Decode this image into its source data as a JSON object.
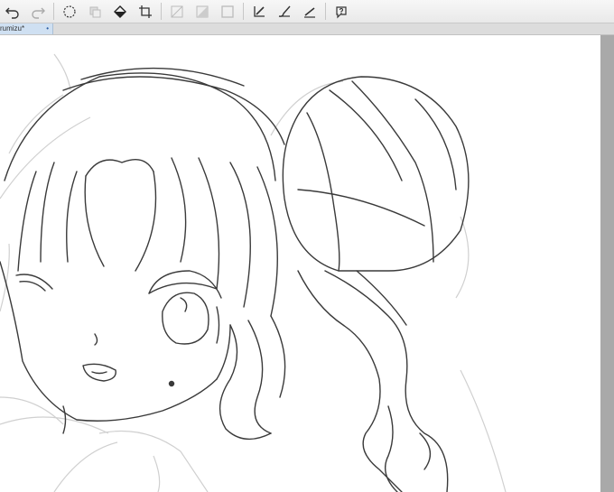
{
  "toolbar": {
    "tools": [
      {
        "icon": "undo-icon"
      },
      {
        "icon": "redo-icon"
      },
      {
        "icon": "lasso-select-icon"
      },
      {
        "icon": "copy-layer-icon"
      },
      {
        "icon": "fill-bucket-icon"
      },
      {
        "icon": "crop-icon"
      },
      {
        "icon": "transparency-grid-icon"
      },
      {
        "icon": "half-tone-icon"
      },
      {
        "icon": "frame-icon"
      },
      {
        "icon": "pen-tool-icon"
      },
      {
        "icon": "brush-tool-icon"
      },
      {
        "icon": "pencil-tool-icon"
      },
      {
        "icon": "help-icon"
      }
    ]
  },
  "document": {
    "tab_label": "rumizu*",
    "close_glyph": "•"
  },
  "colors": {
    "toolbar_bg": "#eeeeee",
    "tab_active": "#cfe0f2",
    "canvas": "#ffffff",
    "line_art": "#3a3a3a",
    "sketch_lines": "#cfcfcf",
    "scrollbar": "#a9a9a9"
  }
}
